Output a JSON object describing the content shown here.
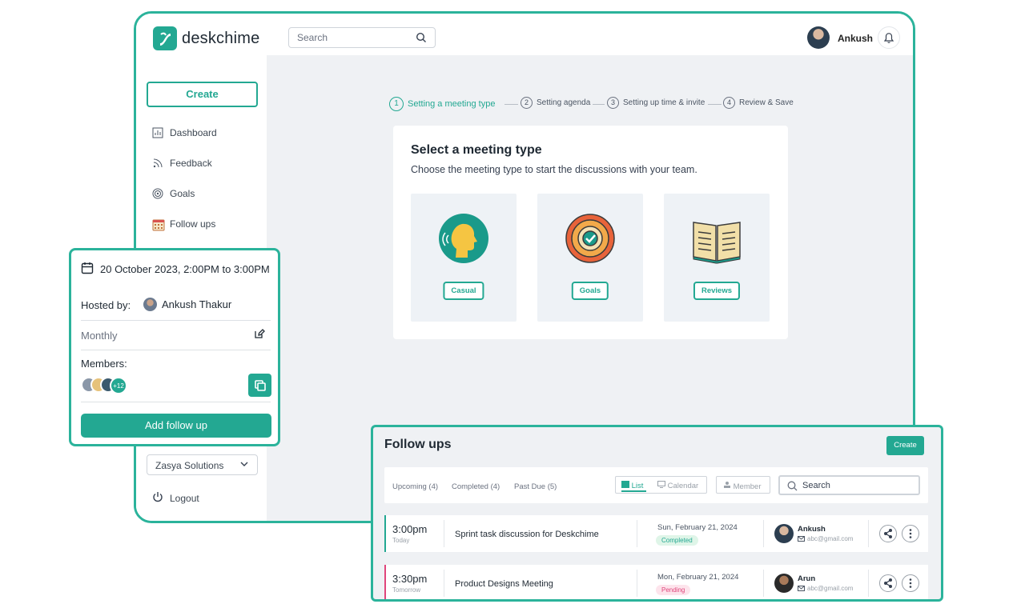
{
  "brand": {
    "name": "deskchime"
  },
  "header": {
    "search_placeholder": "Search",
    "user_name": "Ankush"
  },
  "sidebar": {
    "create_label": "Create",
    "items": [
      {
        "label": "Dashboard",
        "icon": "chart-icon"
      },
      {
        "label": "Feedback",
        "icon": "rss-icon"
      },
      {
        "label": "Goals",
        "icon": "target-icon"
      },
      {
        "label": "Follow ups",
        "icon": "calendar-icon"
      }
    ],
    "org_select": "Zasya Solutions",
    "logout_label": "Logout"
  },
  "stepper": [
    {
      "num": "1",
      "label": "Setting a meeting type",
      "active": true
    },
    {
      "num": "2",
      "label": "Setting agenda"
    },
    {
      "num": "3",
      "label": "Setting up time & invite"
    },
    {
      "num": "4",
      "label": "Review & Save"
    }
  ],
  "meeting_type": {
    "title": "Select a meeting type",
    "subtitle": "Choose the meeting type to start the discussions with your team.",
    "options": [
      "Casual",
      "Goals",
      "Reviews"
    ]
  },
  "meeting_detail": {
    "date": "20 October 2023, 2:00PM to 3:00PM",
    "hosted_label": "Hosted by:",
    "host_name": "Ankush Thakur",
    "frequency": "Monthly",
    "members_label": "Members:",
    "members_more": "+12",
    "add_follow_up": "Add follow up"
  },
  "follow_ups": {
    "title": "Follow ups",
    "create_label": "Create",
    "filters": [
      "Upcoming (4)",
      "Completed (4)",
      "Past Due (5)"
    ],
    "view_list": "List",
    "view_calendar": "Calendar",
    "member_label": "Member",
    "search_placeholder": "Search",
    "rows": [
      {
        "time": "3:00pm",
        "when": "Today",
        "name": "Sprint task discussion for Deskchime",
        "date": "Sun, February 21, 2024",
        "status": "Completed",
        "person": "Ankush",
        "email": "abc@gmail.com"
      },
      {
        "time": "3:30pm",
        "when": "Tomorrow",
        "name": "Product Designs Meeting",
        "date": "Mon, February 21, 2024",
        "status": "Pending",
        "person": "Arun",
        "email": "abc@gmail.com"
      }
    ]
  },
  "colors": {
    "accent": "#23a892",
    "frame": "#2bb39b",
    "pending": "#e0457b",
    "completed_bg": "#dff5e8",
    "pending_bg": "#fde4ec"
  }
}
